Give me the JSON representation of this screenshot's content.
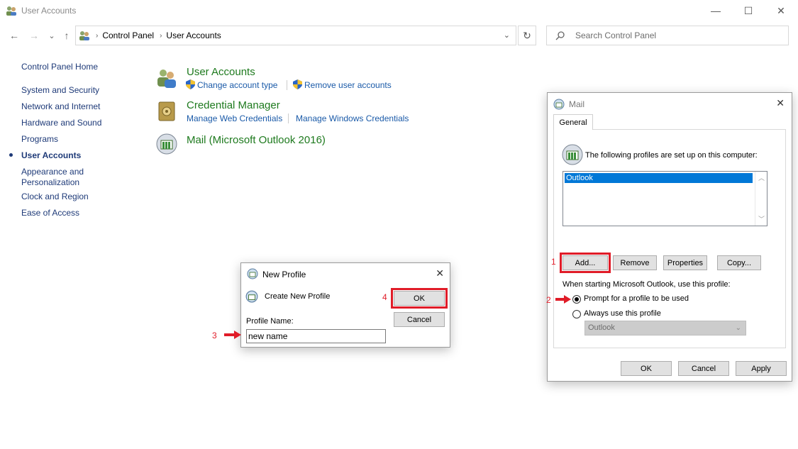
{
  "window": {
    "title": "User Accounts",
    "icon": "users-icon",
    "minimize": "—",
    "maximize": "☐",
    "close": "✕"
  },
  "nav": {
    "back": "←",
    "forward": "→",
    "history": "⌄",
    "up": "↑",
    "breadcrumb": [
      "Control Panel",
      "User Accounts"
    ],
    "search_placeholder": "Search Control Panel"
  },
  "sidebar": {
    "items": [
      {
        "label": "Control Panel Home"
      },
      {
        "label": "System and Security"
      },
      {
        "label": "Network and Internet"
      },
      {
        "label": "Hardware and Sound"
      },
      {
        "label": "Programs"
      },
      {
        "label": "User Accounts",
        "current": true
      },
      {
        "label": "Appearance and\nPersonalization"
      },
      {
        "label": "Clock and Region"
      },
      {
        "label": "Ease of Access"
      }
    ]
  },
  "main": {
    "categories": [
      {
        "title": "User Accounts",
        "links": [
          "Change account type",
          "Remove user accounts"
        ]
      },
      {
        "title": "Credential Manager",
        "links": [
          "Manage Web Credentials",
          "Manage Windows Credentials"
        ]
      },
      {
        "title": "Mail (Microsoft Outlook 2016)",
        "links": []
      }
    ]
  },
  "mail_dialog": {
    "title": "Mail",
    "tab": "General",
    "profiles_label": "The following profiles are set up on this computer:",
    "profiles": [
      "Outlook"
    ],
    "buttons": {
      "add": "Add...",
      "remove": "Remove",
      "properties": "Properties",
      "copy": "Copy..."
    },
    "startup_label": "When starting Microsoft Outlook, use this profile:",
    "radio_prompt": "Prompt for a profile to be used",
    "radio_always": "Always use this profile",
    "combo_value": "Outlook",
    "footer": {
      "ok": "OK",
      "cancel": "Cancel",
      "apply": "Apply"
    }
  },
  "new_profile_dialog": {
    "title": "New Profile",
    "heading": "Create New Profile",
    "field_label": "Profile Name:",
    "field_value": "new name",
    "ok": "OK",
    "cancel": "Cancel"
  },
  "annotations": {
    "step1": "1",
    "step2": "2",
    "step3": "3",
    "step4": "4"
  },
  "colors": {
    "accent_red": "#e01c28",
    "link_blue": "#1a5aa8",
    "title_green": "#1e7a1e",
    "selection": "#0078d7"
  }
}
